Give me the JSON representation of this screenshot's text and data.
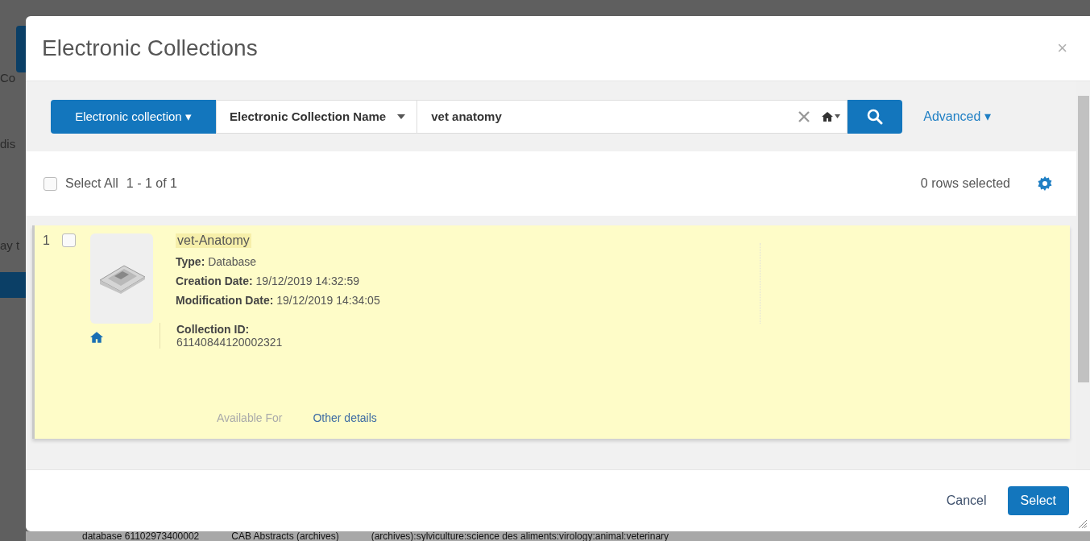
{
  "background": {
    "fragments": [
      "Co",
      "dis",
      "ay t"
    ],
    "bottom_row": [
      "database 61102973400002",
      "CAB Abstracts (archives)",
      "(archives):sylviculture:science des aliments:virology:animal:veterinary"
    ]
  },
  "dialog": {
    "title": "Electronic Collections",
    "close": "×"
  },
  "search": {
    "scope": "Electronic collection ▾",
    "field": "Electronic Collection Name",
    "value": "vet anatomy",
    "advanced": "Advanced ▾"
  },
  "list_header": {
    "select_all": {
      "label": "Select All",
      "checked": false
    },
    "range": "1 - 1 of 1",
    "selected_count": "0 rows selected"
  },
  "results": [
    {
      "number": "1",
      "checked": false,
      "title": "vet-Anatomy",
      "fields": [
        {
          "label": "Type:",
          "value": "Database"
        },
        {
          "label": "Creation Date:",
          "value": "19/12/2019 14:32:59"
        },
        {
          "label": "Modification Date:",
          "value": "19/12/2019 14:34:05"
        }
      ],
      "collection_id": {
        "label": "Collection ID:",
        "value": "61140844120002321"
      },
      "tabs": [
        {
          "label": "Available For",
          "disabled": true
        },
        {
          "label": "Other details",
          "disabled": false
        }
      ]
    }
  ],
  "buttons": [
    {
      "label": "Cancel",
      "kind": "link"
    },
    {
      "label": "Select",
      "kind": "primary"
    }
  ]
}
